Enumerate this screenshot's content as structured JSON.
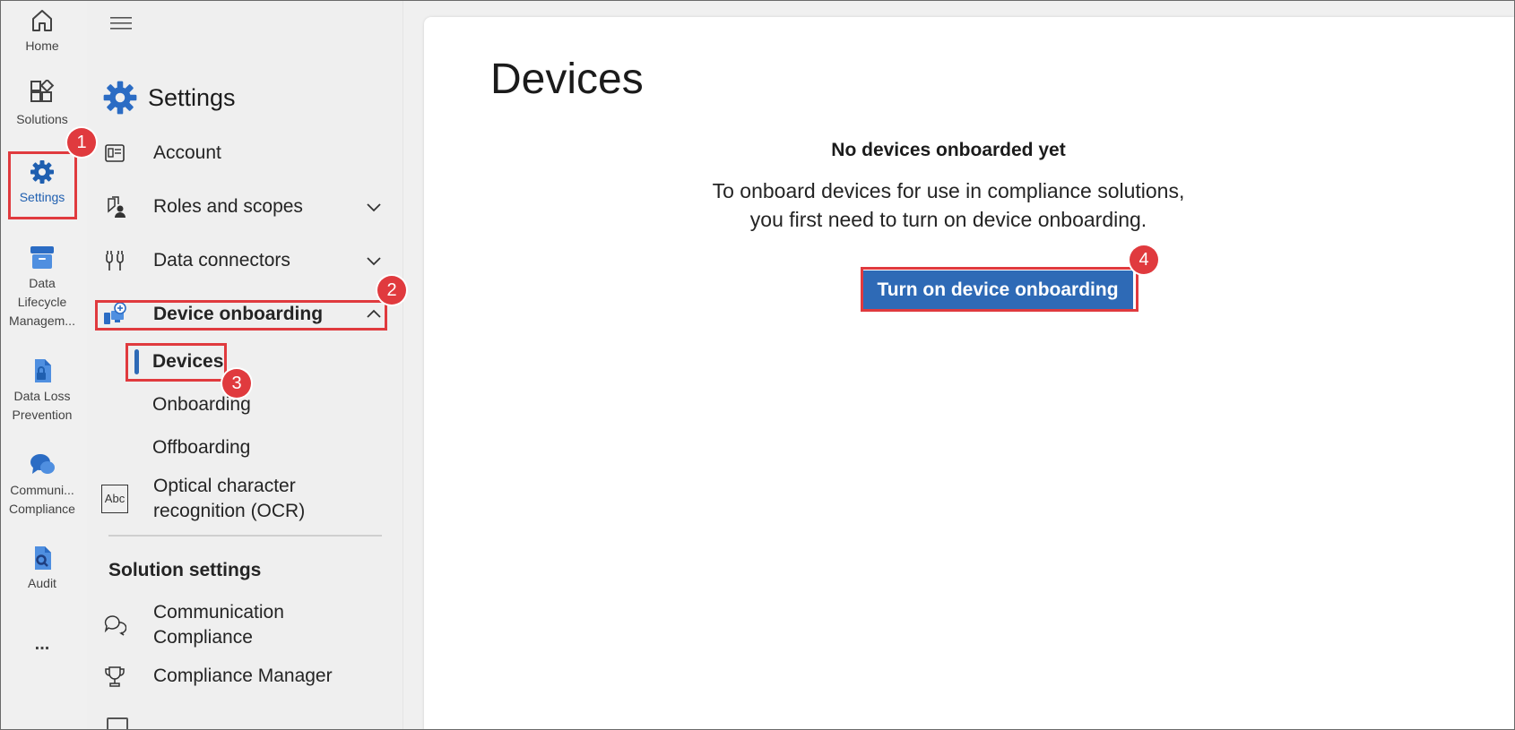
{
  "rail": {
    "items": [
      {
        "label": "Home",
        "icon": "home-icon"
      },
      {
        "label": "Solutions",
        "icon": "solutions-icon"
      },
      {
        "label": "Settings",
        "icon": "gear-icon",
        "active": true
      },
      {
        "label_lines": [
          "Data",
          "Lifecycle",
          "Managem..."
        ],
        "icon": "archive-icon"
      },
      {
        "label_lines": [
          "Data Loss",
          "Prevention"
        ],
        "icon": "lock-document-icon"
      },
      {
        "label_lines": [
          "Communi...",
          "Compliance"
        ],
        "icon": "chat-icon"
      },
      {
        "label": "Audit",
        "icon": "audit-search-icon"
      }
    ],
    "more": "..."
  },
  "nav": {
    "title": "Settings",
    "items": [
      {
        "label": "Account",
        "icon": "account-card-icon"
      },
      {
        "label": "Roles and scopes",
        "icon": "roles-icon",
        "expandable": true
      },
      {
        "label": "Data connectors",
        "icon": "plug-icon",
        "expandable": true
      },
      {
        "label": "Device onboarding",
        "icon": "device-add-icon",
        "expanded": true,
        "children": [
          {
            "label": "Devices",
            "selected": true
          },
          {
            "label": "Onboarding"
          },
          {
            "label": "Offboarding"
          }
        ]
      },
      {
        "label_lines": [
          "Optical character",
          "recognition (OCR)"
        ],
        "icon": "abc-icon",
        "icon_text": "Abc"
      }
    ],
    "section_title": "Solution settings",
    "section_items": [
      {
        "label_lines": [
          "Communication",
          "Compliance"
        ],
        "icon": "chat-icon"
      },
      {
        "label": "Compliance Manager",
        "icon": "trophy-icon"
      }
    ]
  },
  "main": {
    "title": "Devices",
    "empty_title": "No devices onboarded yet",
    "empty_desc": "To onboard devices for use in compliance solutions, you first need to turn on device onboarding.",
    "button_label": "Turn on device onboarding"
  },
  "annotations": [
    "1",
    "2",
    "3",
    "4"
  ],
  "colors": {
    "accent": "#2e6ab6",
    "highlight": "#e03a3e"
  }
}
